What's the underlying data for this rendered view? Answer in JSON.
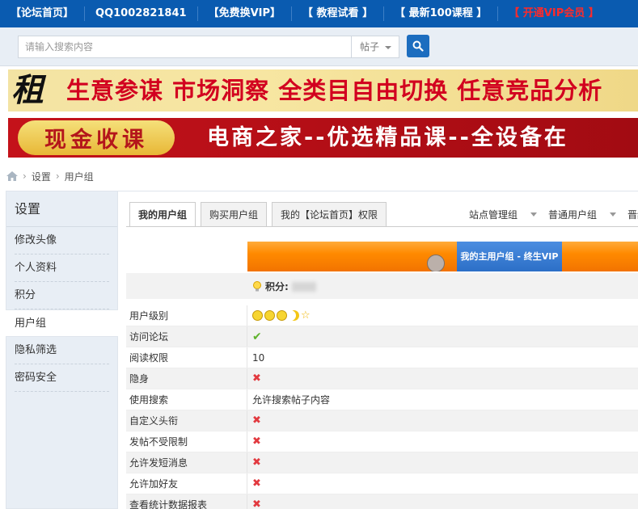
{
  "topnav": {
    "items": [
      {
        "label": "【论坛首页】"
      },
      {
        "label": "QQ1002821841"
      },
      {
        "label": "【免费换VIP】"
      },
      {
        "label": "【 教程试看 】"
      },
      {
        "label": "【 最新100课程 】"
      },
      {
        "label": "【 开通VIP会员 】"
      }
    ]
  },
  "search": {
    "placeholder": "请输入搜索内容",
    "type_selected": "帖子"
  },
  "banners": {
    "banner1_icon_text": "租",
    "banner1_slogan": "生意参谋 市场洞察 全类目自由切换 任意竞品分析",
    "banner2_pill": "现金收课",
    "banner2_text": "电商之家--优选精品课--全设备在"
  },
  "breadcrumb": {
    "items": [
      "设置",
      "用户组"
    ]
  },
  "sidebar": {
    "title": "设置",
    "items": [
      {
        "label": "修改头像"
      },
      {
        "label": "个人资料"
      },
      {
        "label": "积分"
      },
      {
        "label": "用户组"
      },
      {
        "label": "隐私筛选"
      },
      {
        "label": "密码安全"
      }
    ]
  },
  "tabs": {
    "items": [
      {
        "label": "我的用户组"
      },
      {
        "label": "购买用户组"
      },
      {
        "label": "我的【论坛首页】权限"
      }
    ],
    "right": [
      {
        "label": "站点管理组"
      },
      {
        "label": "普通用户组"
      },
      {
        "label": "晋级"
      }
    ]
  },
  "progress": {
    "segment_label": "我的主用户组 - 终生VIP"
  },
  "points": {
    "label": "积分:"
  },
  "permissions": {
    "rows": [
      {
        "key": "用户级别",
        "value": "",
        "type": "level"
      },
      {
        "key": "访问论坛",
        "value": "",
        "type": "check"
      },
      {
        "key": "阅读权限",
        "value": "10",
        "type": "text"
      },
      {
        "key": "隐身",
        "value": "",
        "type": "cross"
      },
      {
        "key": "使用搜索",
        "value": "允许搜索帖子内容",
        "type": "text"
      },
      {
        "key": "自定义头衔",
        "value": "",
        "type": "cross"
      },
      {
        "key": "发帖不受限制",
        "value": "",
        "type": "cross"
      },
      {
        "key": "允许发短消息",
        "value": "",
        "type": "cross"
      },
      {
        "key": "允许加好友",
        "value": "",
        "type": "cross"
      },
      {
        "key": "查看统计数据报表",
        "value": "",
        "type": "cross"
      }
    ]
  },
  "colors": {
    "nav_bg": "#0a5bb0",
    "accent_orange": "#ff8a00",
    "accent_blue": "#2c6fc7",
    "cross_red": "#e2393f",
    "check_green": "#5fb32c"
  }
}
